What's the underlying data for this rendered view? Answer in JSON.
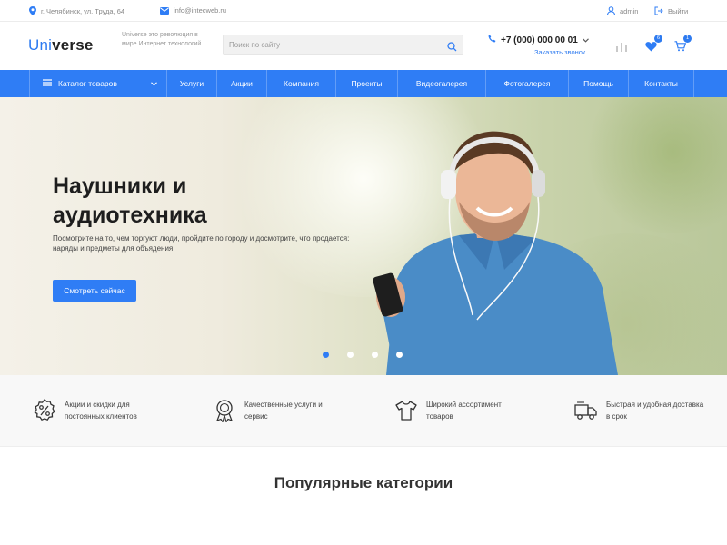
{
  "topbar": {
    "address": "г. Челябинск, ул. Труда, 64",
    "email": "info@intecweb.ru",
    "user": "admin",
    "logout": "Выйти"
  },
  "header": {
    "logo_part1": "Uni",
    "logo_part2": "verse",
    "tagline": "Universe это революция в мире Интернет технологий",
    "search_placeholder": "Поиск по сайту",
    "phone": "+7 (000) 000 00 01",
    "callback": "Заказать звонок",
    "favorites_count": "6",
    "cart_count": "1"
  },
  "nav": {
    "catalog": "Каталог товаров",
    "items": [
      "Услуги",
      "Акции",
      "Компания",
      "Проекты",
      "Видеогалерея",
      "Фотогалерея",
      "Помощь",
      "Контакты"
    ]
  },
  "hero": {
    "title": "Наушники и аудиотехника",
    "text": "Посмотрите на то, чем торгуют люди, пройдите по городу и досмотрите, что продается: наряды и предметы для объядения.",
    "button": "Смотреть сейчас",
    "active_slide": 1,
    "slide_count": 4
  },
  "features": [
    {
      "icon": "discount-icon",
      "text": "Акции и скидки для постоянных клиентов"
    },
    {
      "icon": "quality-award-icon",
      "text": "Качественные услуги и сервис"
    },
    {
      "icon": "tshirt-icon",
      "text": "Широкий ассортимент товаров"
    },
    {
      "icon": "delivery-truck-icon",
      "text": "Быстрая и удобная доставка в срок"
    }
  ],
  "sections": {
    "popular_title": "Популярные категории"
  },
  "colors": {
    "accent": "#2f7df5"
  }
}
